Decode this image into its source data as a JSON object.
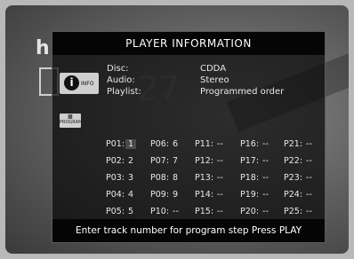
{
  "background": {
    "letter": "h",
    "number": "27"
  },
  "title": "PLAYER INFORMATION",
  "buttons": {
    "info": {
      "symbol": "i",
      "label": "INFO"
    },
    "program": {
      "label": "PROGRAM"
    }
  },
  "info": {
    "disc_label": "Disc:",
    "disc_value": "CDDA",
    "audio_label": "Audio:",
    "audio_value": "Stereo",
    "playlist_label": "Playlist:",
    "playlist_value": "Programmed order"
  },
  "program_steps": [
    {
      "step": "P01:",
      "track": "1",
      "selected": true
    },
    {
      "step": "P02:",
      "track": "2"
    },
    {
      "step": "P03:",
      "track": "3"
    },
    {
      "step": "P04:",
      "track": "4"
    },
    {
      "step": "P05:",
      "track": "5"
    },
    {
      "step": "P06:",
      "track": "6"
    },
    {
      "step": "P07:",
      "track": "7"
    },
    {
      "step": "P08:",
      "track": "8"
    },
    {
      "step": "P09:",
      "track": "9"
    },
    {
      "step": "P10:",
      "track": "--"
    },
    {
      "step": "P11:",
      "track": "--"
    },
    {
      "step": "P12:",
      "track": "--"
    },
    {
      "step": "P13:",
      "track": "--"
    },
    {
      "step": "P14:",
      "track": "--"
    },
    {
      "step": "P15:",
      "track": "--"
    },
    {
      "step": "P16:",
      "track": "--"
    },
    {
      "step": "P17:",
      "track": "--"
    },
    {
      "step": "P18:",
      "track": "--"
    },
    {
      "step": "P19:",
      "track": "--"
    },
    {
      "step": "P20:",
      "track": "--"
    },
    {
      "step": "P21:",
      "track": "--"
    },
    {
      "step": "P22:",
      "track": "--"
    },
    {
      "step": "P23:",
      "track": "--"
    },
    {
      "step": "P24:",
      "track": "--"
    },
    {
      "step": "P25:",
      "track": "--"
    }
  ],
  "footer": "Enter track number for program step Press PLAY"
}
